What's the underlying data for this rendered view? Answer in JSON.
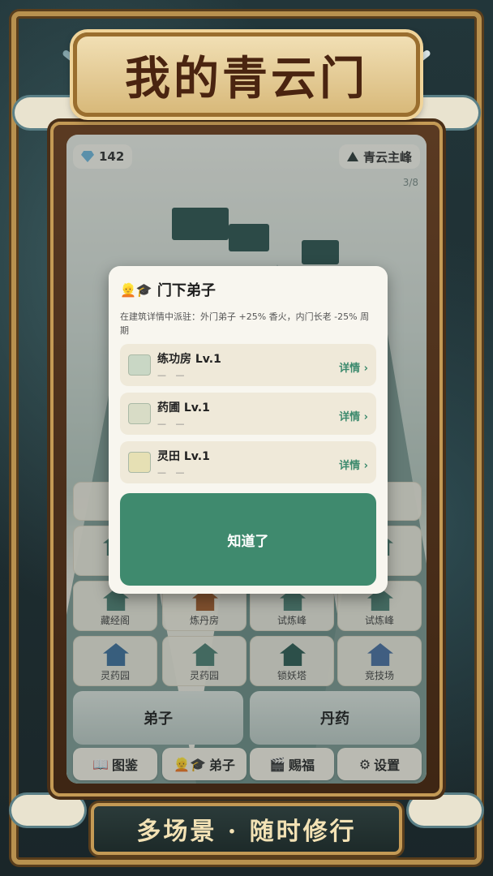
{
  "title": "我的青云门",
  "top_bar": {
    "gems": "142",
    "location": "青云主峰",
    "page_indicator": "3/8"
  },
  "modal": {
    "title": "门下弟子",
    "title_emoji": "👱🎓",
    "description": "在建筑详情中派驻：外门弟子 +25% 香火，内门长老 -25% 周期",
    "rows": [
      {
        "name": "练功房 Lv.1",
        "sub": "— —",
        "link": "详情 ›"
      },
      {
        "name": "药圃 Lv.1",
        "sub": "— —",
        "link": "详情 ›"
      },
      {
        "name": "灵田 Lv.1",
        "sub": "— —",
        "link": "详情 ›"
      }
    ],
    "confirm_label": "知道了"
  },
  "grid": {
    "row3": [
      "藏经阁",
      "炼丹房",
      "试炼峰",
      "试炼峰"
    ],
    "row4": [
      "灵药园",
      "灵药园",
      "锁妖塔",
      "竞技场"
    ]
  },
  "big_tiles": [
    "弟子",
    "丹药"
  ],
  "tabs": [
    {
      "icon": "📖",
      "label": "图鉴"
    },
    {
      "icon": "👱🎓",
      "label": "弟子"
    },
    {
      "icon": "🎬",
      "label": "赐福"
    },
    {
      "icon": "⚙",
      "label": "设置"
    }
  ],
  "footer": "多场景 · 随时修行"
}
